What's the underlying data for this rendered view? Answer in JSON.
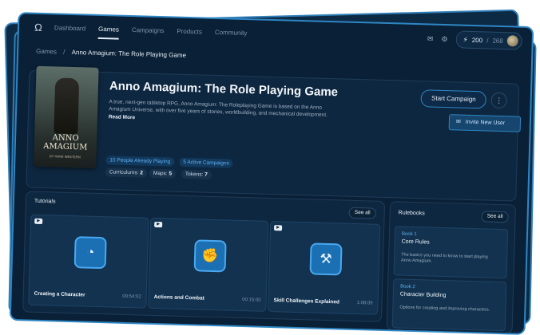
{
  "nav": {
    "items": [
      "Dashboard",
      "Games",
      "Campaigns",
      "Products",
      "Community"
    ],
    "active": "Games"
  },
  "header": {
    "tokens_used": "200",
    "tokens_sep": "/",
    "tokens_total": "268"
  },
  "breadcrumb": {
    "root": "Games",
    "separator": "/",
    "current": "Anno Amagium: The Role Playing Game"
  },
  "game": {
    "title": "Anno Amagium: The Role Playing Game",
    "description": "A true, next-gen tabletop RPG, Anno Amagium: The Roleplaying Game is based on the Anno Amagium Universe, with over five years of stories, worldbuilding, and mechanical development.",
    "read_more": "Read More",
    "cover_title_line1": "ANNO",
    "cover_title_line2": "AMAGIUM",
    "cover_byline": "BY HANK WESTERN",
    "stats": {
      "playing": "15 People Already Playing",
      "campaigns": "5 Active Campaigns",
      "curriculums_label": "Curriculums:",
      "curriculums_value": "2",
      "maps_label": "Maps:",
      "maps_value": "5",
      "tokens_label": "Tokens:",
      "tokens_value": "7"
    },
    "start_campaign": "Start Campaign",
    "more_symbol": "⋮",
    "invite_user": "Invite New User"
  },
  "tutorials": {
    "title": "Tutorials",
    "see_all": "See all",
    "items": [
      {
        "name": "Creating a Character",
        "duration": "00:54:02",
        "icon": "character-icon"
      },
      {
        "name": "Actions and Combat",
        "duration": "00:15:00",
        "icon": "fist-icon"
      },
      {
        "name": "Skill Challenges Explained",
        "duration": "1:08:09",
        "icon": "hammer-icon"
      }
    ]
  },
  "rulebooks": {
    "title": "Rulebooks",
    "see_all": "See all",
    "items": [
      {
        "number": "Book 1",
        "name": "Core Rules",
        "description": "The basics you need to know to start playing Anno Amagium."
      },
      {
        "number": "Book 2",
        "name": "Character Building",
        "description": "Options for creating and improving characters."
      }
    ]
  },
  "colors": {
    "background": "#0a2036",
    "accent": "#2f86c4",
    "accent_text": "#5fb0f0"
  }
}
